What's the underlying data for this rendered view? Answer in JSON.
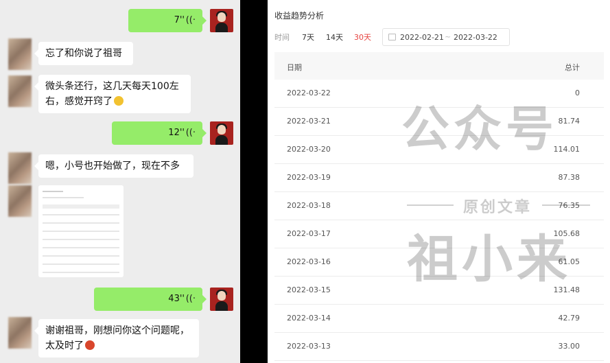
{
  "chat": {
    "messages": [
      {
        "side": "right",
        "type": "voice",
        "duration": "7''"
      },
      {
        "side": "left",
        "type": "text",
        "text": "忘了和你说了祖哥"
      },
      {
        "side": "left",
        "type": "text",
        "lines": [
          "微头条还行，这几天每天100左",
          "右，感觉开窍了"
        ],
        "emoji": "smile-emoji"
      },
      {
        "side": "right",
        "type": "voice",
        "duration": "12''"
      },
      {
        "side": "left",
        "type": "text",
        "text": "嗯，小号也开始做了，现在不多"
      },
      {
        "side": "left",
        "type": "image",
        "description": "screenshot"
      },
      {
        "side": "right",
        "type": "voice",
        "duration": "43''"
      },
      {
        "side": "left",
        "type": "text",
        "lines": [
          "谢谢祖哥，刚想问你这个问题呢，",
          "太及时了"
        ],
        "emoji": "party-emoji"
      }
    ],
    "voice_icon": "sound-wave-icon",
    "colors": {
      "voice_bubble": "#95ec69",
      "chat_bg": "#ededed",
      "text_bubble": "#ffffff"
    }
  },
  "panel": {
    "title": "收益趋势分析",
    "filter_label": "时间",
    "filter_options": [
      {
        "label": "7天",
        "active": false
      },
      {
        "label": "14天",
        "active": false
      },
      {
        "label": "30天",
        "active": true
      }
    ],
    "date_start": "2022-02-21",
    "date_sep": "~",
    "date_end": "2022-03-22",
    "columns": [
      "日期",
      "总计"
    ],
    "rows": [
      {
        "date": "2022-03-22",
        "total": "0"
      },
      {
        "date": "2022-03-21",
        "total": "81.74"
      },
      {
        "date": "2022-03-20",
        "total": "114.01"
      },
      {
        "date": "2022-03-19",
        "total": "87.38"
      },
      {
        "date": "2022-03-18",
        "total": "76.35"
      },
      {
        "date": "2022-03-17",
        "total": "105.68"
      },
      {
        "date": "2022-03-16",
        "total": "61.05"
      },
      {
        "date": "2022-03-15",
        "total": "131.48"
      },
      {
        "date": "2022-03-14",
        "total": "42.79"
      },
      {
        "date": "2022-03-13",
        "total": "33.00"
      }
    ],
    "accent_color": "#e64340"
  },
  "watermark": {
    "top": "公众号",
    "middle": "原创文章",
    "bottom": "祖小来"
  }
}
